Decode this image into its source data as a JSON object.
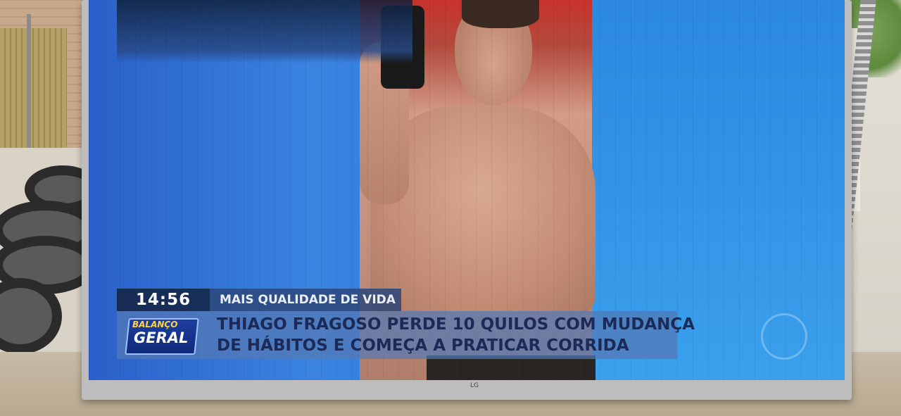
{
  "broadcast": {
    "clock": "14:56",
    "segment_tag": "MAIS QUALIDADE DE VIDA",
    "headline_line1": "THIAGO FRAGOSO PERDE 10 QUILOS COM MUDANÇA",
    "headline_line2": "DE HÁBITOS E COMEÇA A PRATICAR CORRIDA",
    "program_logo_top": "BALANÇO",
    "program_logo_bottom": "GERAL"
  },
  "tv": {
    "brand": "LG"
  },
  "colors": {
    "screen_blue": "#2f74d9",
    "lower_third_dark": "#14234a",
    "headline_text": "#1c2a57"
  }
}
